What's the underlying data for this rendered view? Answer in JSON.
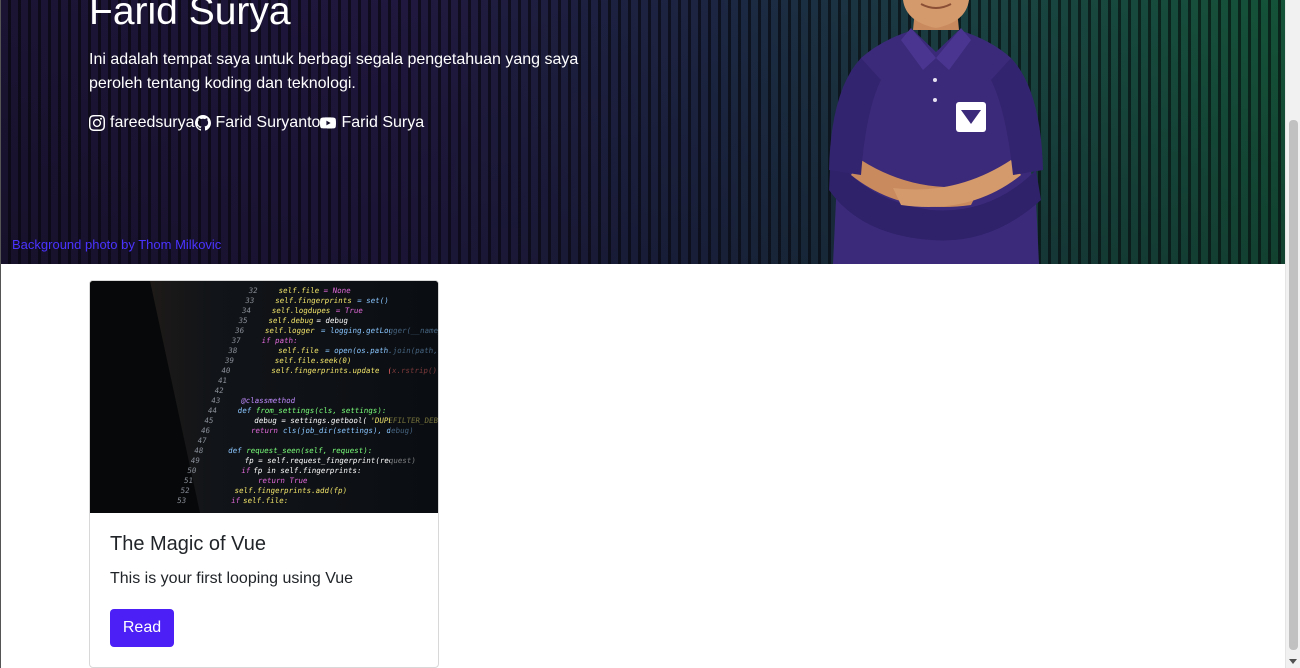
{
  "hero": {
    "title": "Farid Surya",
    "description": "Ini adalah tempat saya untuk berbagi segala pengetahuan yang saya peroleh tentang koding dan teknologi.",
    "socials": [
      {
        "icon": "instagram-icon",
        "label": "fareedsurya"
      },
      {
        "icon": "github-icon",
        "label": "Farid Suryanto"
      },
      {
        "icon": "youtube-icon",
        "label": "Farid Surya"
      }
    ],
    "credit": "Background photo by Thom Milkovic"
  },
  "cards": [
    {
      "title": "The Magic of Vue",
      "text": "This is your first looping using Vue",
      "button": "Read"
    }
  ],
  "colors": {
    "accent": "#4b1ff5",
    "credit_link": "#4a33ff",
    "shirt": "#3b2a7a"
  }
}
